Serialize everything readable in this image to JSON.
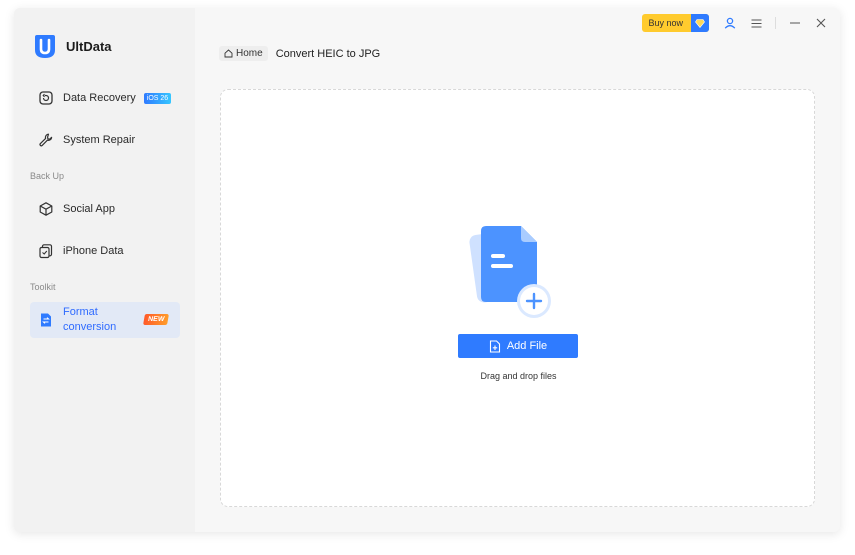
{
  "app": {
    "name": "UltData"
  },
  "sidebar": {
    "items": [
      {
        "label": "Data Recovery",
        "icon": "data-recovery-icon",
        "badge": "iOS 26"
      },
      {
        "label": "System Repair",
        "icon": "wrench-icon"
      },
      {
        "label": "Social App",
        "icon": "cube-icon"
      },
      {
        "label": "iPhone Data",
        "icon": "phone-data-icon"
      },
      {
        "label": "Format conversion",
        "icon": "format-conversion-icon",
        "badge": "NEW",
        "active": true
      }
    ],
    "sections": {
      "backup": "Back Up",
      "toolkit": "Toolkit"
    }
  },
  "topbar": {
    "buy_label": "Buy now"
  },
  "breadcrumb": {
    "home": "Home",
    "title": "Convert HEIC to JPG"
  },
  "dropzone": {
    "button_label": "Add File",
    "hint": "Drag and drop files"
  },
  "colors": {
    "accent": "#2f7bff",
    "buy": "#ffcb2e",
    "new_badge": "#ff6a2a"
  }
}
